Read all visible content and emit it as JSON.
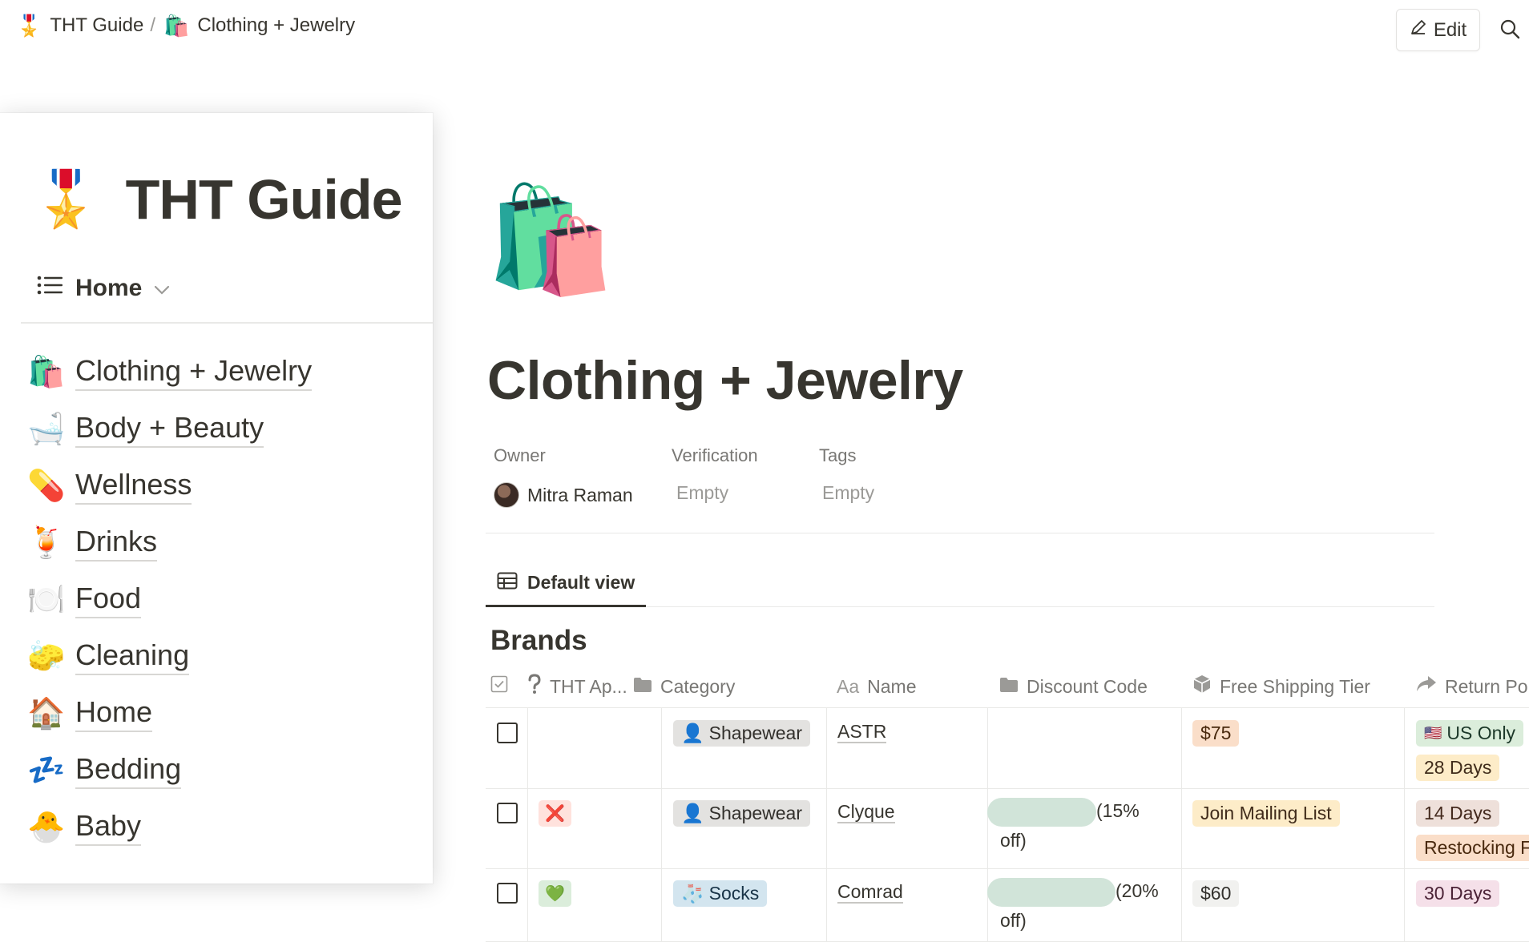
{
  "breadcrumb": {
    "items": [
      {
        "icon": "medal-icon",
        "emoji": "🎖️",
        "label": "THT Guide"
      },
      {
        "icon": "shopping-bags-icon",
        "emoji": "🛍️",
        "label": "Clothing + Jewelry"
      }
    ],
    "separator": "/"
  },
  "toolbar": {
    "edit_label": "Edit",
    "search_icon": "search-icon"
  },
  "sidebar": {
    "title": "THT Guide",
    "title_emoji": "🎖️",
    "nav_label": "Home",
    "items": [
      {
        "emoji": "🛍️",
        "label": "Clothing + Jewelry"
      },
      {
        "emoji": "🛁",
        "label": "Body + Beauty"
      },
      {
        "emoji": "💊",
        "label": "Wellness"
      },
      {
        "emoji": "🍹",
        "label": "Drinks"
      },
      {
        "emoji": "🍽️",
        "label": "Food"
      },
      {
        "emoji": "🧽",
        "label": "Cleaning"
      },
      {
        "emoji": "🏠",
        "label": "Home"
      },
      {
        "emoji": "💤",
        "label": "Bedding"
      },
      {
        "emoji": "🐣",
        "label": "Baby"
      }
    ]
  },
  "page": {
    "icon_emoji": "🛍️",
    "title": "Clothing + Jewelry",
    "properties": {
      "owner": {
        "label": "Owner",
        "value": "Mitra Raman"
      },
      "verification": {
        "label": "Verification",
        "value": "Empty"
      },
      "tags": {
        "label": "Tags",
        "value": "Empty"
      }
    },
    "view_tab": "Default view",
    "database_title": "Brands"
  },
  "table": {
    "columns": [
      "",
      "THT Ap...",
      "Category",
      "Name",
      "Discount Code",
      "Free Shipping Tier",
      "Return Po"
    ],
    "column_icons": [
      "checkbox-icon",
      "question-icon",
      "folder-icon",
      "text-icon",
      "folder-icon",
      "box-icon",
      "share-arrow-icon"
    ],
    "name_prefix": "Aa",
    "rows": [
      {
        "checked": false,
        "approval": "",
        "category": {
          "emoji": "👤",
          "label": "Shapewear"
        },
        "name": "ASTR",
        "discount_code": "",
        "discount_rest": "",
        "shipping": "$75",
        "returns": [
          {
            "emoji": "🇺🇸",
            "label": "US Only"
          },
          {
            "emoji": "",
            "label": "28 Days"
          }
        ]
      },
      {
        "checked": false,
        "approval": "❌",
        "category": {
          "emoji": "👤",
          "label": "Shapewear"
        },
        "name": "Clyque",
        "discount_code": "(15%",
        "discount_rest": "off)",
        "shipping": "Join Mailing List",
        "returns": [
          {
            "emoji": "",
            "label": "14 Days"
          },
          {
            "emoji": "",
            "label": "Restocking F"
          }
        ]
      },
      {
        "checked": false,
        "approval": "💚",
        "category": {
          "emoji": "🧦",
          "label": "Socks"
        },
        "name": "Comrad",
        "discount_code": "(20%",
        "discount_rest": "off)",
        "shipping": "$60",
        "returns": [
          {
            "emoji": "",
            "label": "30 Days"
          }
        ]
      }
    ]
  },
  "colors": {
    "text": "#37352f",
    "muted": "#787774",
    "divider": "#e9e9e7",
    "redacted": "#d1e4d9"
  }
}
